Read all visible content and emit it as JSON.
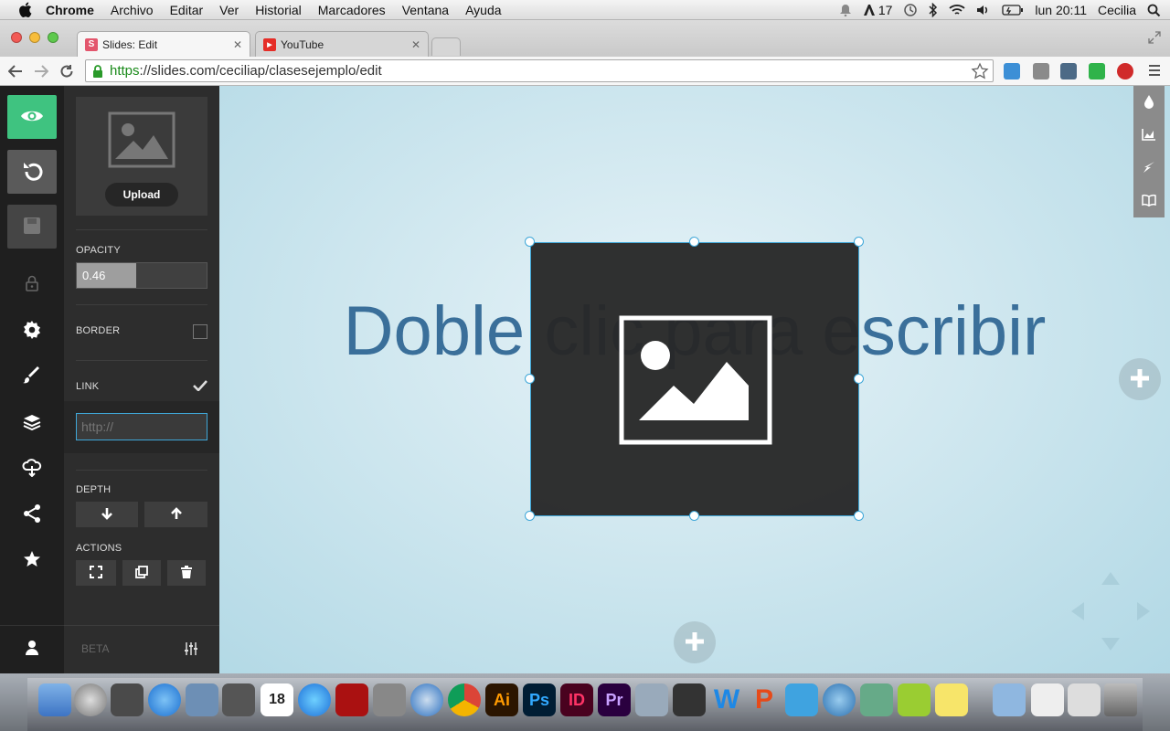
{
  "menubar": {
    "app": "Chrome",
    "items": [
      "Archivo",
      "Editar",
      "Ver",
      "Historial",
      "Marcadores",
      "Ventana",
      "Ayuda"
    ],
    "adobe_count": "17",
    "clock": "lun 20:11",
    "user": "Cecilia"
  },
  "tabs": [
    {
      "title": "Slides: Edit",
      "favicon": "S"
    },
    {
      "title": "YouTube",
      "favicon": "▶"
    }
  ],
  "url": {
    "scheme": "https",
    "rest": "://slides.com/ceciliap/clasesejemplo/edit"
  },
  "panel": {
    "upload_label": "Upload",
    "opacity_label": "OPACITY",
    "opacity_value": "0.46",
    "opacity_fraction": 0.46,
    "border_label": "BORDER",
    "link_label": "LINK",
    "link_placeholder": "http://",
    "depth_label": "DEPTH",
    "actions_label": "ACTIONS",
    "beta_label": "BETA"
  },
  "slide": {
    "text": "Doble clic para escribir"
  },
  "colors": {
    "accent": "#3fc380",
    "selection": "#3fa7d8",
    "slide_text": "#3a6f9a"
  },
  "dock": {
    "calendar_day": "18"
  }
}
